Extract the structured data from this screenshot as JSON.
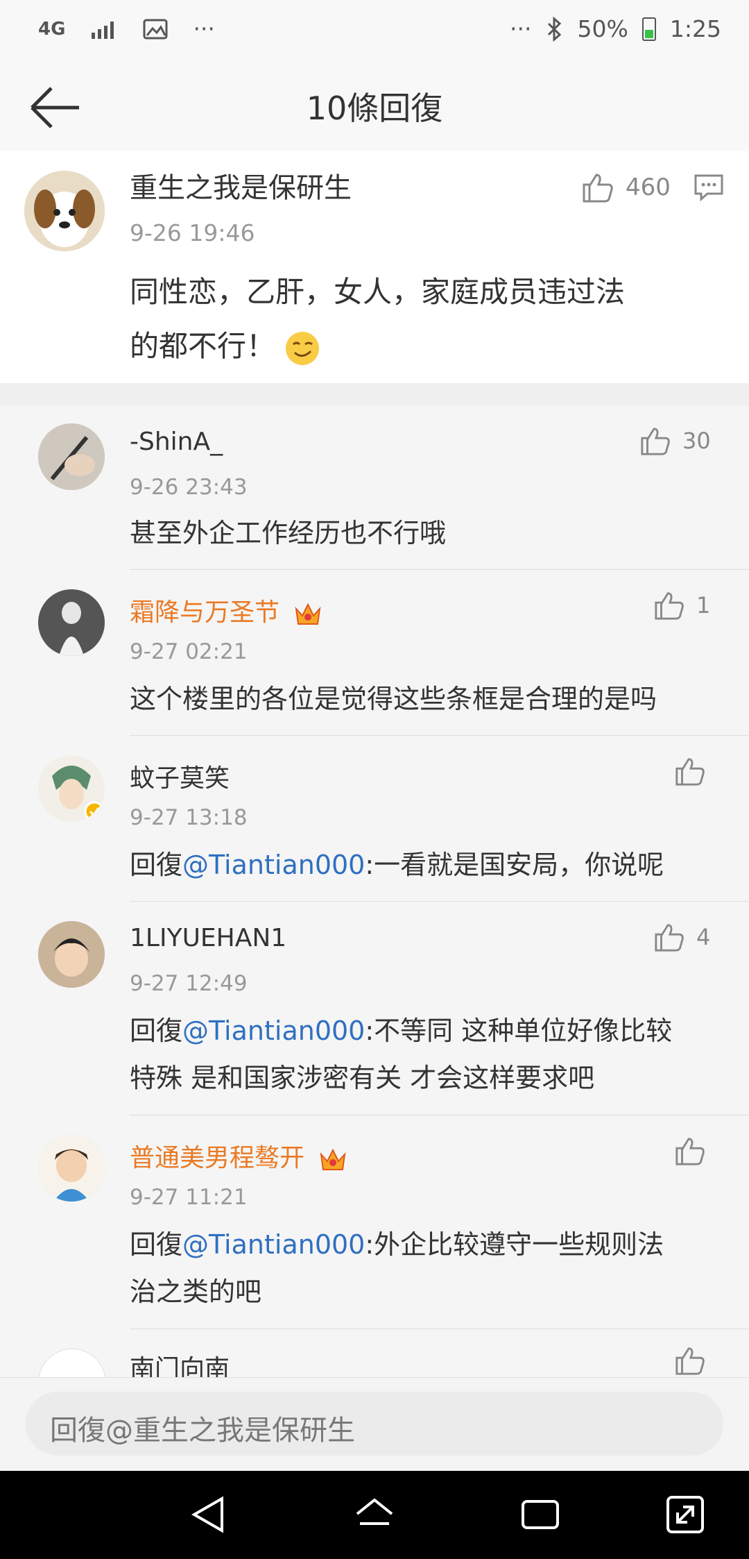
{
  "status_bar": {
    "left_icons": [
      "4G",
      "signal-bars",
      "image",
      "···"
    ],
    "right_text": [
      "···",
      "bluetooth",
      "50%",
      "1:25"
    ]
  },
  "header": {
    "title": "10條回復"
  },
  "main_comment": {
    "author": "重生之我是保研生",
    "time": "9-26 19:46",
    "likes": "460",
    "content_line1": "同性恋，乙肝，女人，家庭成员违过法",
    "content_line2": "的都不行！"
  },
  "replies": [
    {
      "author": "-ShinA_",
      "time": "9-26 23:43",
      "likes": "30",
      "content": "甚至外企工作经历也不行哦"
    },
    {
      "author": "霜降与万圣节",
      "time": "9-27 02:21",
      "likes": "1",
      "content": "这个楼里的各位是觉得这些条框是合理的是吗"
    },
    {
      "author": "蚊子莫笑",
      "time": "9-27 13:18",
      "likes": "",
      "mention": "@Tiantian000",
      "reply_prefix": "回復",
      "content": ":一看就是国安局，你说呢"
    },
    {
      "author": "1LIYUEHAN1",
      "time": "9-27 12:49",
      "likes": "4",
      "mention": "@Tiantian000",
      "reply_prefix": "回復",
      "content": ":不等同 这种单位好像比较",
      "content2": "特殊 是和国家涉密有关 才会这样要求吧"
    },
    {
      "author": "普通美男程骜开",
      "time": "9-27 11:21",
      "likes": "",
      "mention": "@Tiantian000",
      "reply_prefix": "回復",
      "content": ":外企比较遵守一些规则法",
      "content2": "治之类的吧"
    },
    {
      "author": "南门向南",
      "time": "",
      "likes": ""
    }
  ],
  "input": {
    "placeholder": "回復@重生之我是保研生"
  },
  "colors": {
    "orange_name": "#ea7a25",
    "mention_blue": "#2f6fc0"
  }
}
